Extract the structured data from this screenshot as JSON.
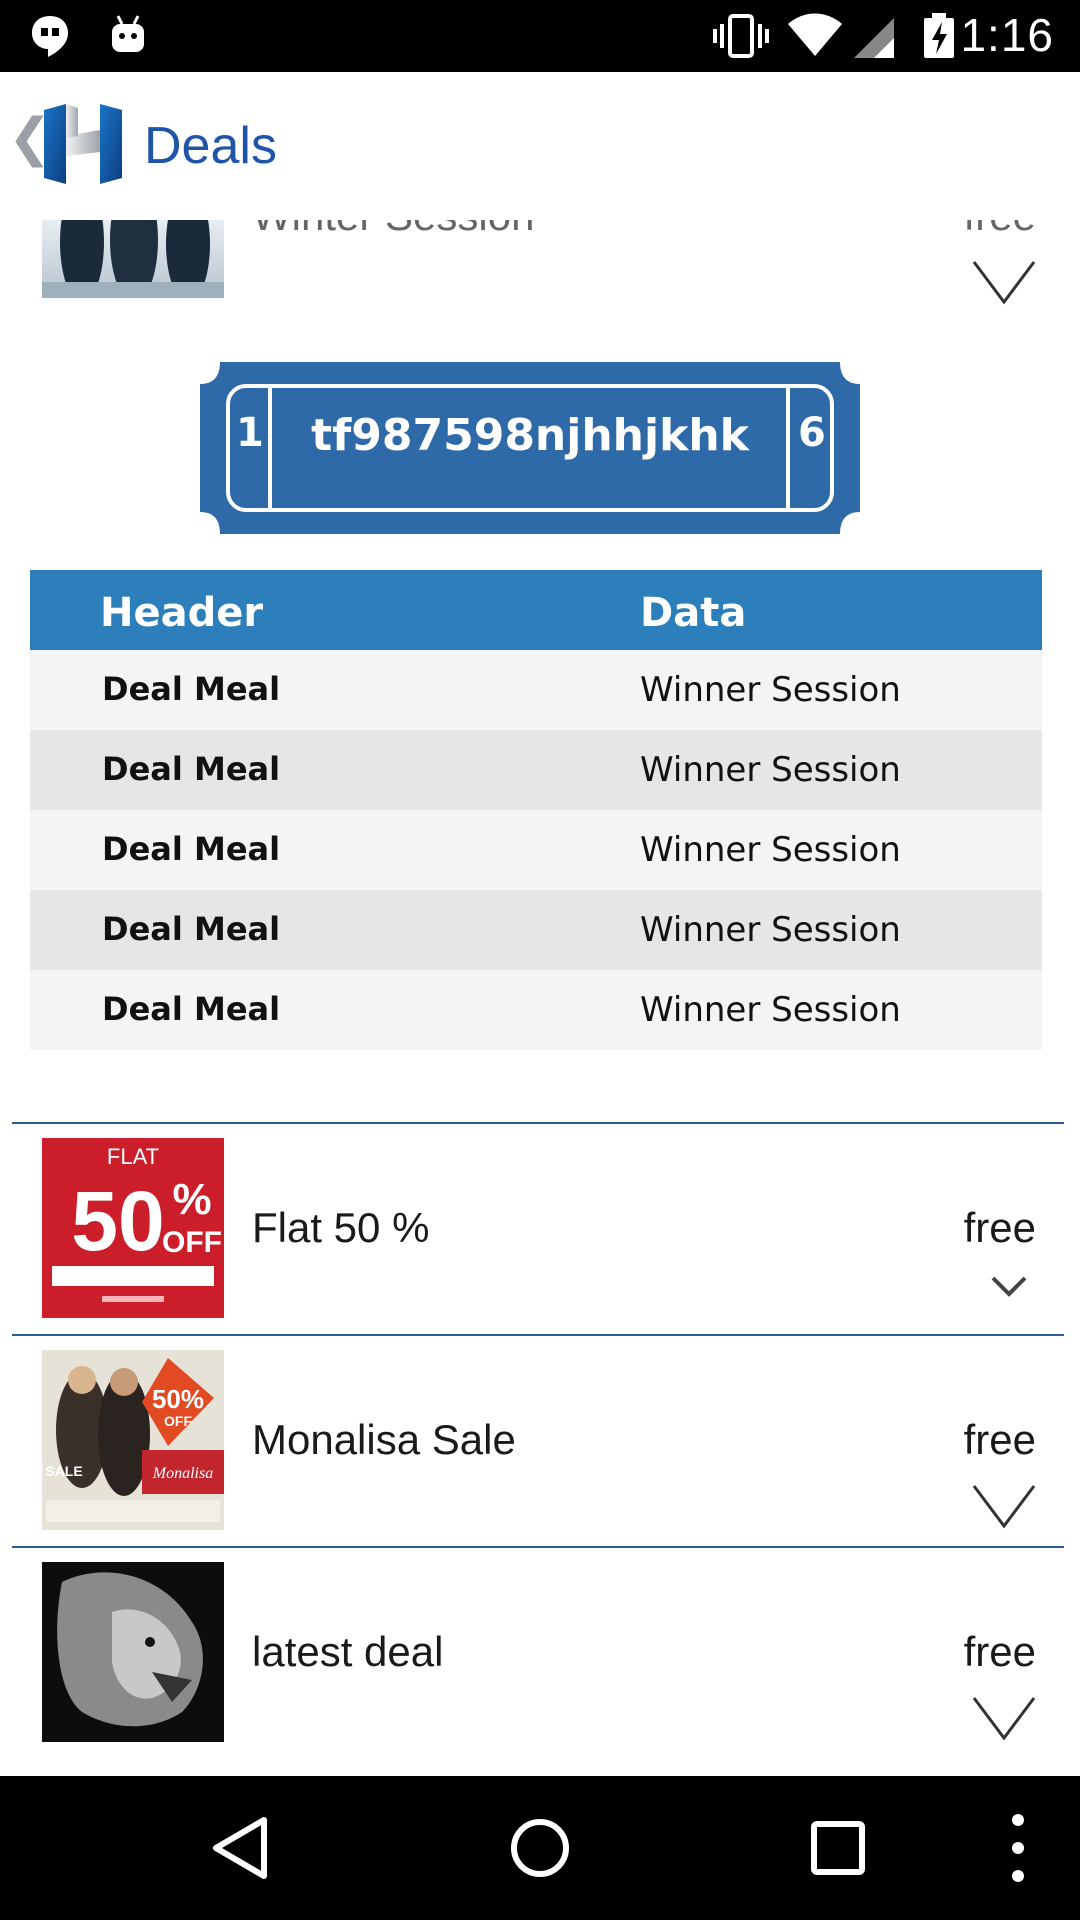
{
  "status_bar": {
    "time": "1:16",
    "icons": [
      "hangouts-icon",
      "android-icon",
      "vibrate-icon",
      "wifi-icon",
      "signal-icon",
      "battery-charging-icon"
    ]
  },
  "app_bar": {
    "title": "Deals",
    "back_icon": "chevron-left-icon",
    "logo_icon": "app-logo"
  },
  "deals_top": {
    "title": "Winter Session",
    "price": "free",
    "expand_icon": "chevron-down-icon"
  },
  "coupon": {
    "code": "tf987598njhhjkhk",
    "left_number": "1",
    "right_number": "6",
    "color": "#2f6aa8"
  },
  "table": {
    "headers": [
      "Header",
      "Data"
    ],
    "rows": [
      [
        "Deal Meal",
        "Winner Session"
      ],
      [
        "Deal Meal",
        "Winner Session"
      ],
      [
        "Deal Meal",
        "Winner Session"
      ],
      [
        "Deal Meal",
        "Winner Session"
      ],
      [
        "Deal Meal",
        "Winner Session"
      ]
    ],
    "header_color": "#2c7fba"
  },
  "deals": [
    {
      "title": "Flat 50 %",
      "price": "free",
      "thumb_text": [
        "FLAT",
        "50%",
        "OFF"
      ]
    },
    {
      "title": "Monalisa Sale",
      "price": "free",
      "thumb_text": [
        "50%",
        "OFF",
        "Monalisa",
        "SALE"
      ]
    },
    {
      "title": "latest deal",
      "price": "free",
      "thumb_icon": "lion-image"
    }
  ],
  "nav_bar": {
    "icons": [
      "back-triangle-icon",
      "home-circle-icon",
      "recents-square-icon",
      "overflow-menu-icon"
    ]
  }
}
